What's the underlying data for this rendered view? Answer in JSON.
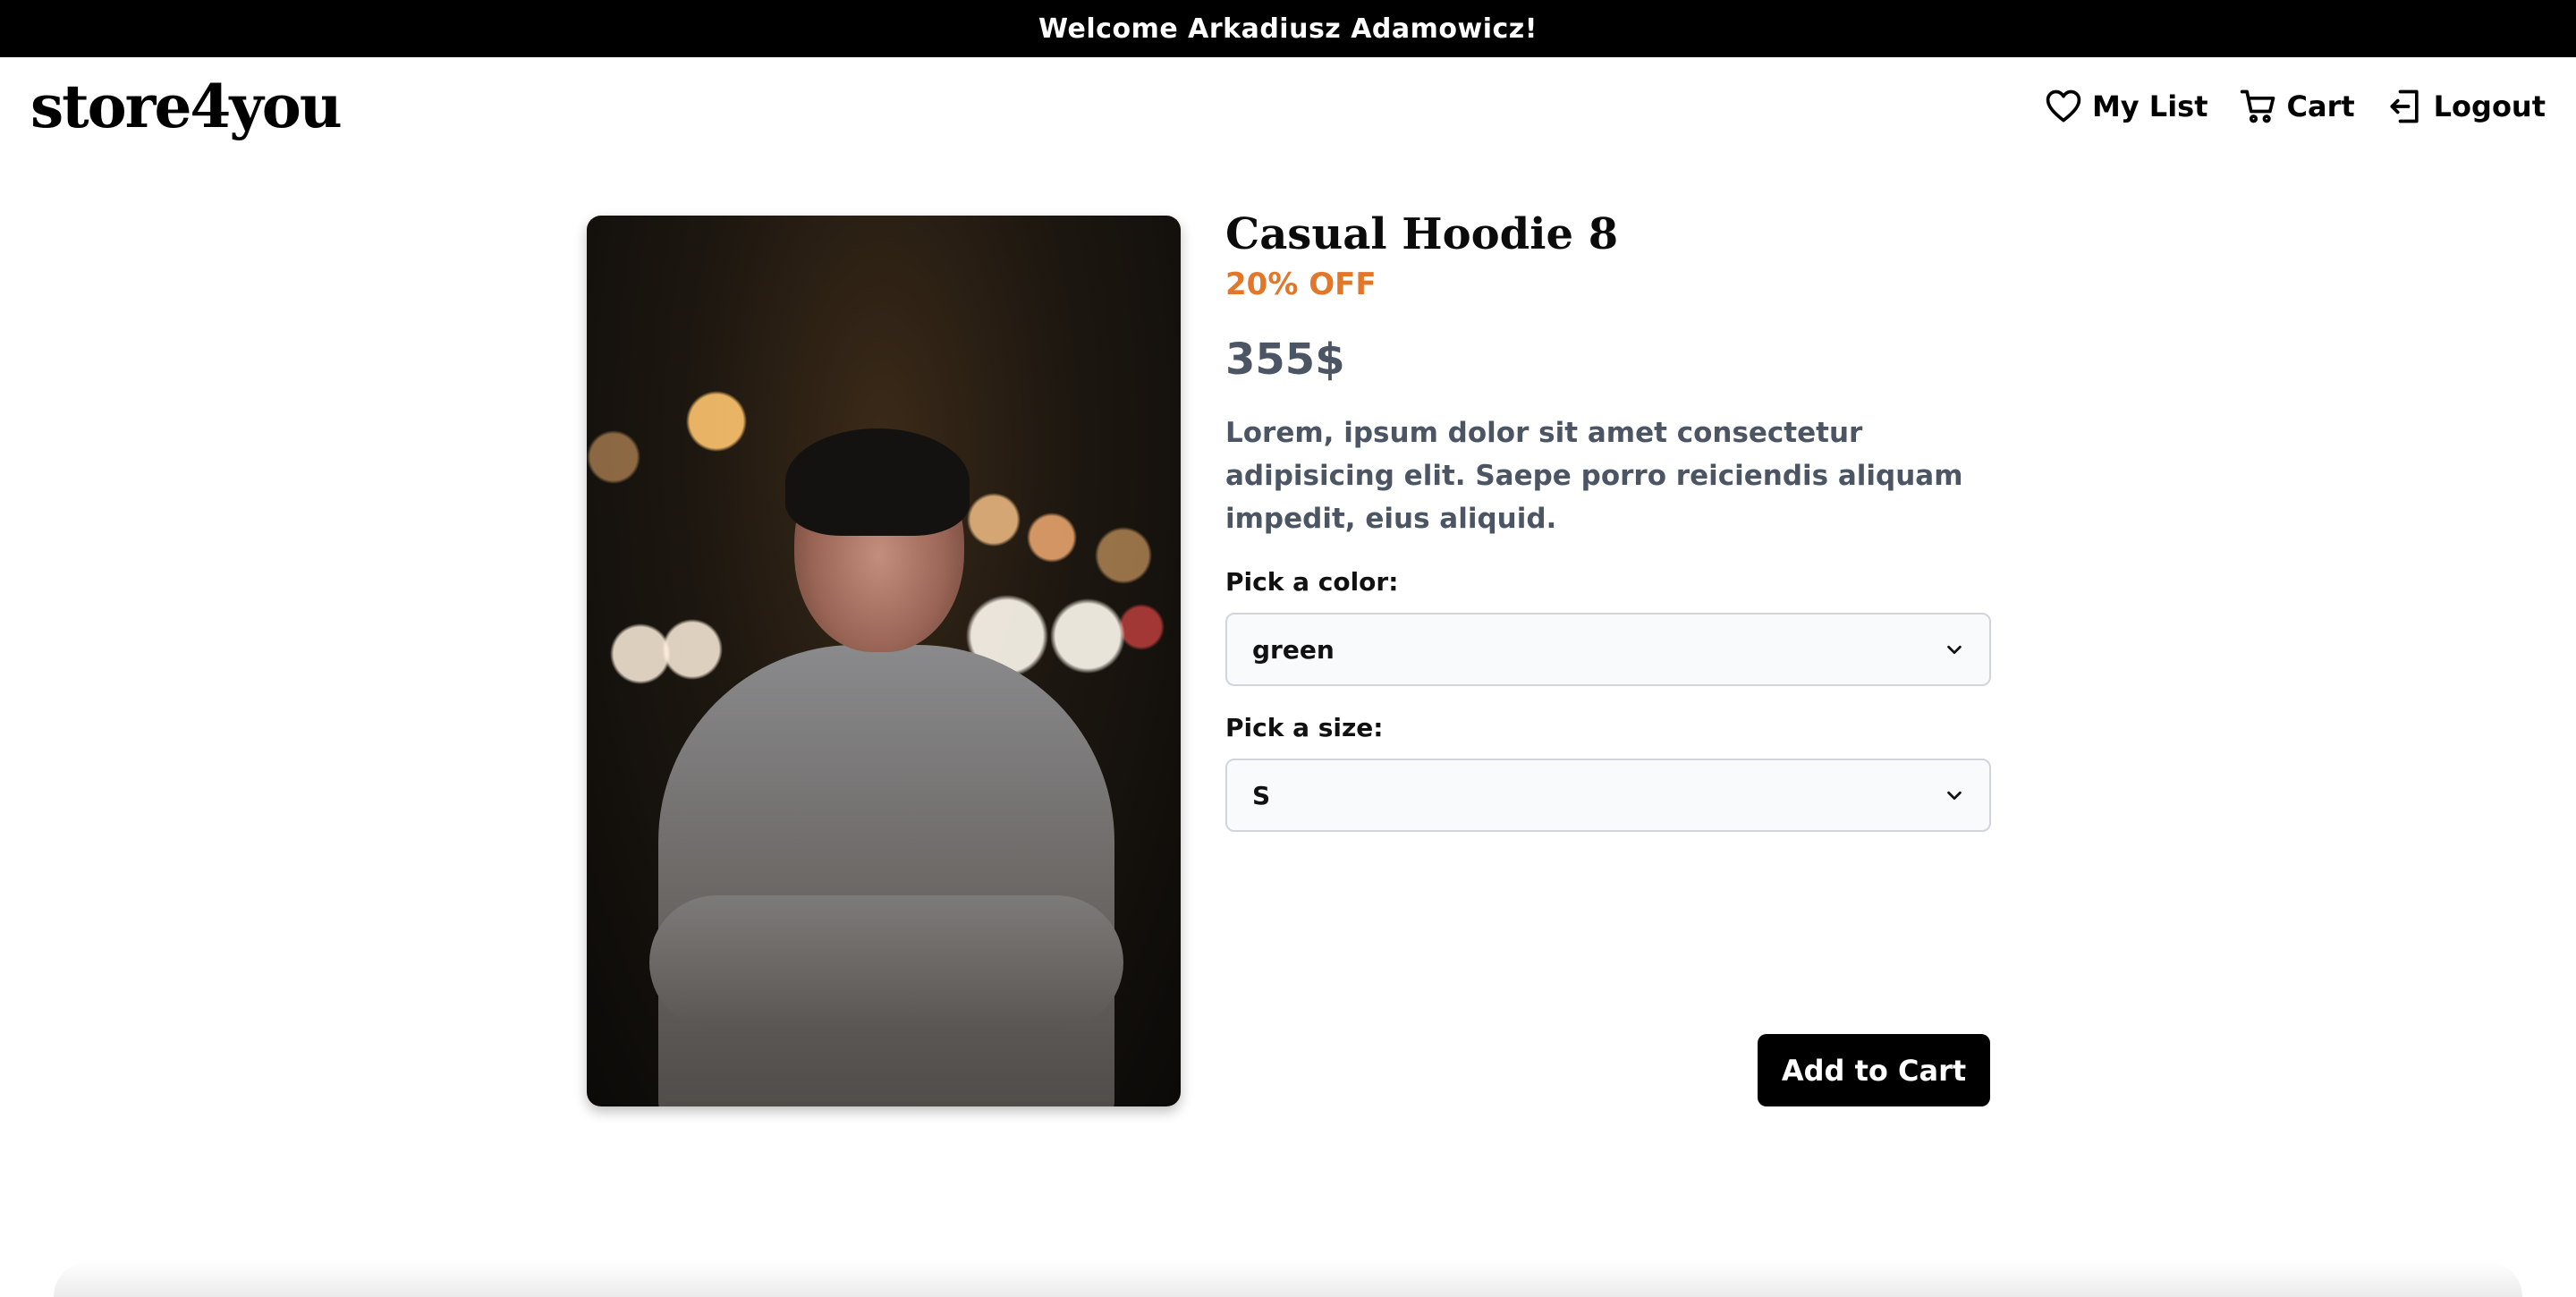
{
  "banner": {
    "welcome": "Welcome Arkadiusz Adamowicz!"
  },
  "header": {
    "logo": "store4you",
    "nav": {
      "my_list": "My List",
      "cart": "Cart",
      "logout": "Logout"
    },
    "icons": [
      "heart-icon",
      "cart-icon",
      "logout-icon"
    ]
  },
  "product": {
    "title": "Casual Hoodie 8",
    "discount": "20% OFF",
    "price": "355$",
    "description": "Lorem, ipsum dolor sit amet consectetur adipisicing elit. Saepe porro reiciendis aliquam impedit, eius aliquid.",
    "color_label": "Pick a color:",
    "color_value": "green",
    "size_label": "Pick a size:",
    "size_value": "S",
    "add_to_cart": "Add to Cart"
  },
  "colors": {
    "banner_bg": "#000000",
    "discount": "#e2772a",
    "price_text": "#4b5563",
    "button_bg": "#000000"
  }
}
